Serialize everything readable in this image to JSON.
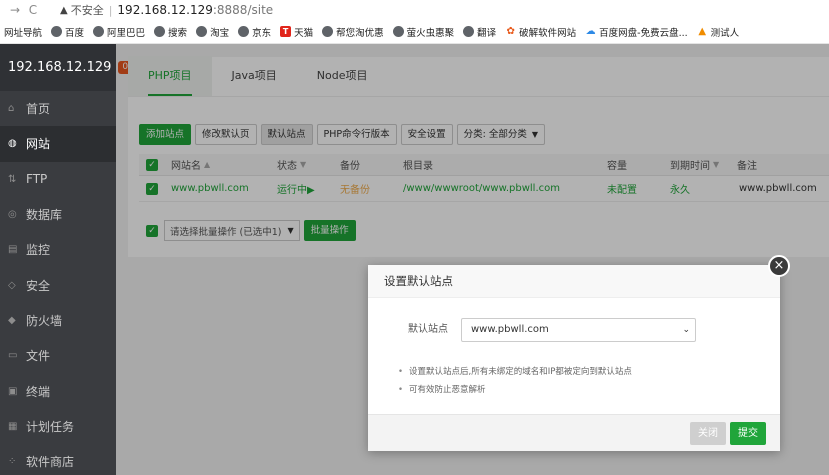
{
  "browser": {
    "back_icon": "→",
    "reload_icon": "C",
    "security_label": "不安全",
    "url_host": "192.168.12.129",
    "url_rest": ":8888/site"
  },
  "bookmarks": [
    {
      "label": "网址导航",
      "icon": "none"
    },
    {
      "label": "百度",
      "icon": "globe"
    },
    {
      "label": "阿里巴巴",
      "icon": "globe"
    },
    {
      "label": "搜索",
      "icon": "globe"
    },
    {
      "label": "淘宝",
      "icon": "globe"
    },
    {
      "label": "京东",
      "icon": "globe"
    },
    {
      "label": "天猫",
      "icon": "tmall"
    },
    {
      "label": "帮您淘优惠",
      "icon": "globe"
    },
    {
      "label": "萤火虫惠聚",
      "icon": "globe"
    },
    {
      "label": "翻译",
      "icon": "globe"
    },
    {
      "label": "破解软件网站",
      "icon": "crack"
    },
    {
      "label": "百度网盘-免费云盘...",
      "icon": "cloud"
    },
    {
      "label": "测试人",
      "icon": "test"
    }
  ],
  "sidebar": {
    "host": "192.168.12.129",
    "badge": "0",
    "items": [
      {
        "label": "首页",
        "active": false
      },
      {
        "label": "网站",
        "active": true
      },
      {
        "label": "FTP",
        "active": false
      },
      {
        "label": "数据库",
        "active": false
      },
      {
        "label": "监控",
        "active": false
      },
      {
        "label": "安全",
        "active": false
      },
      {
        "label": "防火墙",
        "active": false
      },
      {
        "label": "文件",
        "active": false
      },
      {
        "label": "终端",
        "active": false
      },
      {
        "label": "计划任务",
        "active": false
      },
      {
        "label": "软件商店",
        "active": false
      }
    ]
  },
  "tabs": [
    "PHP项目",
    "Java项目",
    "Node项目"
  ],
  "toolbar": {
    "add_site": "添加站点",
    "edit_default_page": "修改默认页",
    "default_site": "默认站点",
    "php_cli_version": "PHP命令行版本",
    "security_settings": "安全设置",
    "category": "分类: 全部分类"
  },
  "table": {
    "headers": {
      "name": "网站名",
      "status": "状态",
      "backup": "备份",
      "root": "根目录",
      "quota": "容量",
      "expire": "到期时间",
      "remark": "备注"
    },
    "rows": [
      {
        "name": "www.pbwll.com",
        "status": "运行中▶",
        "backup": "无备份",
        "root": "/www/wwwroot/www.pbwll.com",
        "quota": "未配置",
        "expire": "永久",
        "remark": "www.pbwll.com"
      }
    ]
  },
  "batch": {
    "select_placeholder": "请选择批量操作 (已选中1)",
    "button": "批量操作"
  },
  "dialog": {
    "title": "设置默认站点",
    "field_label": "默认站点",
    "selected_site": "www.pbwll.com",
    "tips": [
      "设置默认站点后,所有未绑定的域名和IP都被定向到默认站点",
      "可有效防止恶意解析"
    ],
    "close_button": "关闭",
    "submit_button": "提交",
    "close_icon": "×"
  },
  "colors": {
    "accent": "#20a53a",
    "sidebar_bg": "#3a3c40",
    "warn_orange": "#f0ad4e",
    "badge": "#e8561f"
  }
}
